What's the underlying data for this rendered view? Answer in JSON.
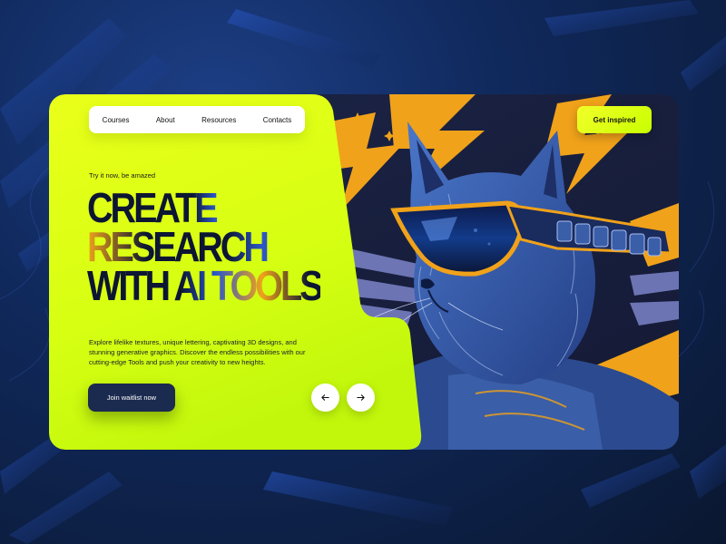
{
  "nav": {
    "items": [
      "Courses",
      "About",
      "Resources",
      "Contacts"
    ]
  },
  "header": {
    "cta_label": "Get inspired"
  },
  "hero": {
    "tagline": "Try it now, be amazed",
    "headline_lines": [
      "CREATE",
      "RESEARCH",
      "WITH AI TOOLS"
    ],
    "description": "Explore lifelike textures, unique lettering, captivating 3D designs, and stunning generative graphics. Discover the endless possibilities with our cutting-edge Tools and push your creativity to new heights.",
    "waitlist_label": "Join waitlist now"
  },
  "icons": {
    "prev": "arrow-left-icon",
    "next": "arrow-right-icon",
    "hero_art": "cat-with-sunglasses-illustration"
  },
  "colors": {
    "lime": "#d4ff12",
    "navy": "#1b2a4f",
    "orange": "#f0a21a",
    "blue": "#2e58c8",
    "background": "#10295c"
  }
}
